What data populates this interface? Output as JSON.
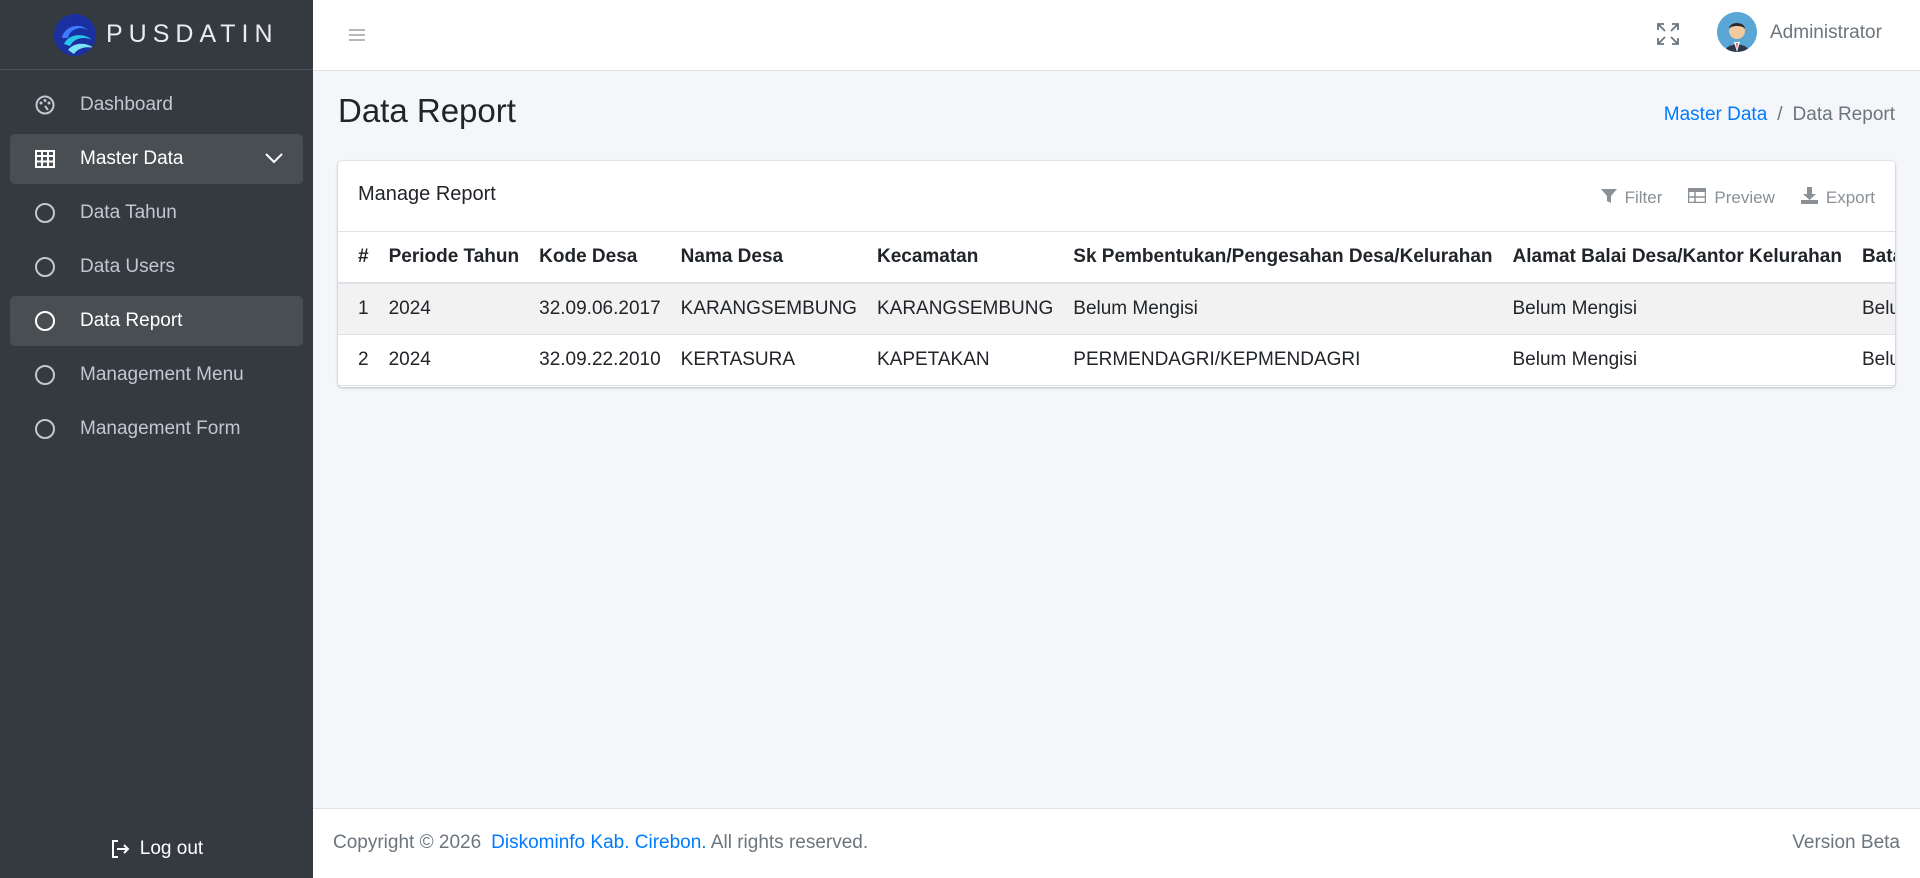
{
  "brand": {
    "name": "PUSDATIN"
  },
  "sidebar": {
    "items": [
      {
        "label": "Dashboard",
        "icon": "palette-icon"
      },
      {
        "label": "Master Data",
        "icon": "table-icon"
      },
      {
        "label": "Data Tahun",
        "icon": "circle-icon"
      },
      {
        "label": "Data Users",
        "icon": "circle-icon"
      },
      {
        "label": "Data Report",
        "icon": "circle-icon"
      },
      {
        "label": "Management Menu",
        "icon": "circle-icon"
      },
      {
        "label": "Management Form",
        "icon": "circle-icon"
      }
    ],
    "logout": "Log out"
  },
  "header": {
    "user": "Administrator"
  },
  "page": {
    "title": "Data Report",
    "breadcrumb": [
      "Master Data",
      "/",
      "Data Report"
    ]
  },
  "card": {
    "title": "Manage Report",
    "tools": [
      "Filter",
      "Preview",
      "Export"
    ]
  },
  "table": {
    "headers": [
      "#",
      "Periode Tahun",
      "Kode Desa",
      "Nama Desa",
      "Kecamatan",
      "Sk Pembentukan/Pengesahan Desa/Kelurahan",
      "Alamat Balai Desa/Kantor Kelurahan",
      "Batas Utara"
    ],
    "rows": [
      [
        "1",
        "2024",
        "32.09.06.2017",
        "KARANGSEMBUNG",
        "KARANGSEMBUNG",
        "Belum Mengisi",
        "Belum Mengisi",
        "Belum Mengisi"
      ],
      [
        "2",
        "2024",
        "32.09.22.2010",
        "KERTASURA",
        "KAPETAKAN",
        "PERMENDAGRI/KEPMENDAGRI",
        "Belum Mengisi",
        "Belum Mengisi"
      ]
    ]
  },
  "footer": {
    "copyright": "Copyright © 2026",
    "org": "Diskominfo Kab. Cirebon.",
    "rights": " All rights reserved.",
    "version": "Version Beta"
  },
  "colors": {
    "sidebar": "#343a40",
    "accent": "#007bff",
    "active": "#494e53"
  }
}
